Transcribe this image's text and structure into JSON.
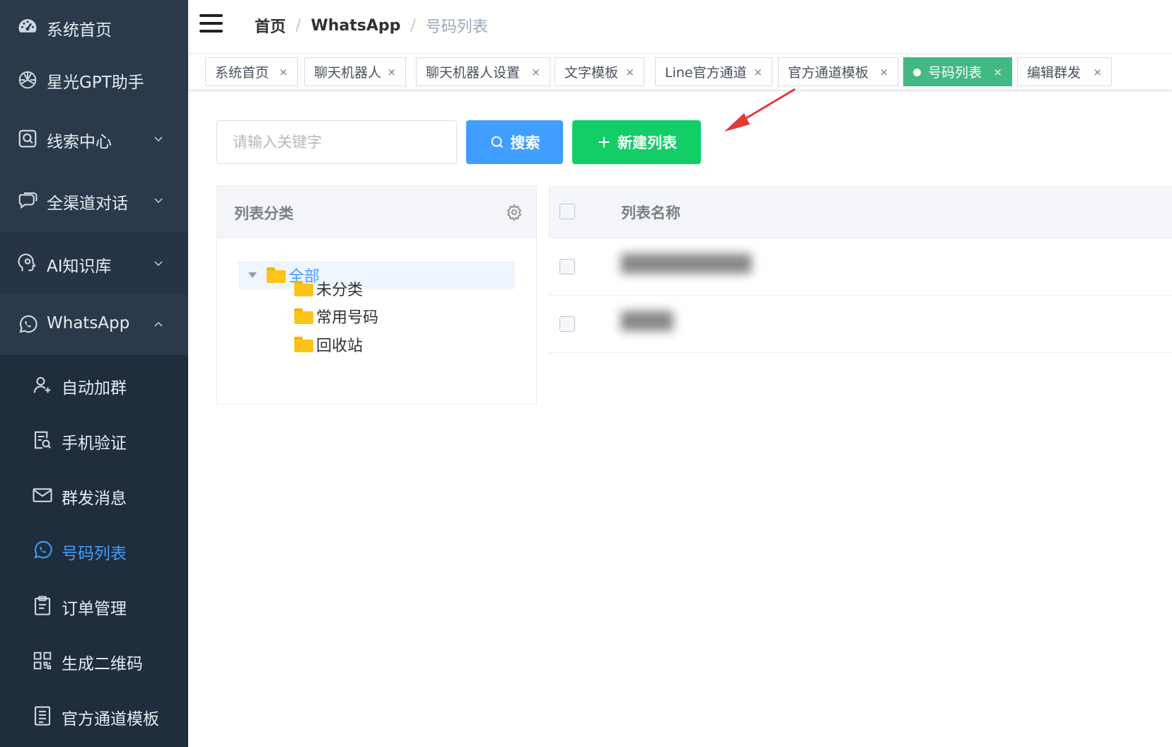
{
  "sidebar": {
    "items": [
      {
        "label": "系统首页",
        "icon": "dashboard-icon"
      },
      {
        "label": "星光GPT助手",
        "icon": "openai-icon"
      },
      {
        "label": "线索中心",
        "icon": "search-box-icon"
      },
      {
        "label": "全渠道对话",
        "icon": "chat-bubbles-icon"
      },
      {
        "label": "AI知识库",
        "icon": "brain-head-icon"
      },
      {
        "label": "WhatsApp",
        "icon": "whatsapp-icon"
      }
    ],
    "subitems": [
      {
        "label": "自动加群",
        "icon": "user-add-icon"
      },
      {
        "label": "手机验证",
        "icon": "doc-search-icon"
      },
      {
        "label": "群发消息",
        "icon": "mail-icon"
      },
      {
        "label": "号码列表",
        "icon": "whatsapp-icon"
      },
      {
        "label": "订单管理",
        "icon": "clipboard-icon"
      },
      {
        "label": "生成二维码",
        "icon": "qrcode-icon"
      },
      {
        "label": "官方通道模板",
        "icon": "list-doc-icon"
      }
    ],
    "active_color": "#409eff"
  },
  "breadcrumb": {
    "home": "首页",
    "section": "WhatsApp",
    "current": "号码列表",
    "separator": "/"
  },
  "tags": [
    {
      "label": "系统首页",
      "close": "×"
    },
    {
      "label": "聊天机器人",
      "close": "×"
    },
    {
      "label": "聊天机器人设置",
      "close": "×"
    },
    {
      "label": "文字模板",
      "close": "×"
    },
    {
      "label": "Line官方通道",
      "close": "×"
    },
    {
      "label": "官方通道模板",
      "close": "×"
    },
    {
      "label": "号码列表",
      "close": "×",
      "active": true
    },
    {
      "label": "编辑群发",
      "close": "×"
    }
  ],
  "toolbar": {
    "search_placeholder": "请输入关键字",
    "search_value": "",
    "search_label": "搜索",
    "add_label": "新建列表"
  },
  "category_panel": {
    "title": "列表分类",
    "tree": {
      "root": "全部",
      "children": [
        "未分类",
        "常用号码",
        "回收站"
      ]
    }
  },
  "table": {
    "columns": [
      "列表名称"
    ],
    "rows": [
      {
        "name": "██████████"
      },
      {
        "name": "████"
      }
    ]
  },
  "colors": {
    "sidebar_bg": "#1f2d3d",
    "primary": "#409eff",
    "success": "#13ce66",
    "active_tag": "#42b983",
    "annotation_arrow": "#e53935"
  }
}
